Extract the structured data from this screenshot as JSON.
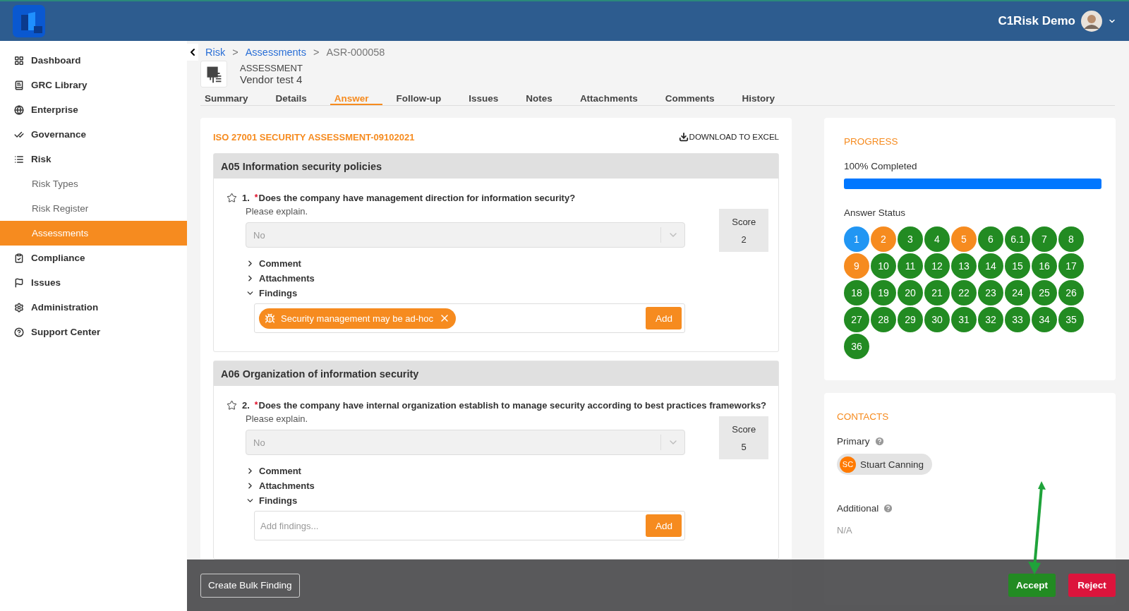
{
  "header": {
    "user_name": "C1Risk Demo"
  },
  "sidebar": {
    "items": [
      {
        "label": "Dashboard",
        "selected": false
      },
      {
        "label": "GRC Library",
        "selected": false
      },
      {
        "label": "Enterprise",
        "selected": false
      },
      {
        "label": "Governance",
        "selected": false
      },
      {
        "label": "Risk",
        "selected": false,
        "children": [
          {
            "label": "Risk Types",
            "selected": false
          },
          {
            "label": "Risk Register",
            "selected": false
          },
          {
            "label": "Assessments",
            "selected": true
          }
        ]
      },
      {
        "label": "Compliance",
        "selected": false
      },
      {
        "label": "Issues",
        "selected": false
      },
      {
        "label": "Administration",
        "selected": false
      },
      {
        "label": "Support Center",
        "selected": false
      }
    ]
  },
  "breadcrumb": [
    {
      "label": "Risk",
      "link": true
    },
    {
      "label": ">",
      "link": false
    },
    {
      "label": "Assessments",
      "link": true
    },
    {
      "label": ">",
      "link": false
    },
    {
      "label": "ASR-000058",
      "link": false
    }
  ],
  "record": {
    "type_label": "ASSESSMENT",
    "name": "Vendor test 4"
  },
  "tabs": [
    {
      "label": "Summary",
      "selected": false
    },
    {
      "label": "Details",
      "selected": false
    },
    {
      "label": "Answer",
      "selected": true
    },
    {
      "label": "Follow-up",
      "selected": false
    },
    {
      "label": "Issues",
      "selected": false
    },
    {
      "label": "Notes",
      "selected": false
    },
    {
      "label": "Attachments",
      "selected": false
    },
    {
      "label": "Comments",
      "selected": false
    },
    {
      "label": "History",
      "selected": false
    }
  ],
  "questionnaire": {
    "title": "ISO 27001 SECURITY ASSESSMENT-09102021",
    "download_label": "DOWNLOAD TO EXCEL",
    "sections": [
      {
        "title": "A05 Information security policies",
        "questions": [
          {
            "number": "1.",
            "required_mark": "*",
            "text": "Does the company have management direction for information security?",
            "hint": "Please explain.",
            "answer": "No",
            "score_label": "Score",
            "score": "2",
            "toggles": [
              {
                "label": "Comment",
                "expanded": false
              },
              {
                "label": "Attachments",
                "expanded": false
              },
              {
                "label": "Findings",
                "expanded": true
              }
            ],
            "findings": [
              {
                "label": "Security management may be ad-hoc"
              }
            ],
            "add_label": "Add"
          }
        ]
      },
      {
        "title": "A06 Organization of information security",
        "questions": [
          {
            "number": "2.",
            "required_mark": "*",
            "text": "Does the company have internal organization establish to manage security according to best practices frameworks?",
            "hint": "Please explain.",
            "answer": "No",
            "score_label": "Score",
            "score": "5",
            "toggles": [
              {
                "label": "Comment",
                "expanded": false
              },
              {
                "label": "Attachments",
                "expanded": false
              },
              {
                "label": "Findings",
                "expanded": true
              }
            ],
            "findings_placeholder": "Add findings...",
            "add_label": "Add"
          }
        ]
      }
    ]
  },
  "progress": {
    "title": "PROGRESS",
    "label": "100% Completed",
    "level": 1,
    "status_title": "Answer Status",
    "answers": [
      {
        "label": "1",
        "color": "#2196f3"
      },
      {
        "label": "2",
        "color": "#f68b1f"
      },
      {
        "label": "3",
        "color": "#228b22"
      },
      {
        "label": "4",
        "color": "#228b22"
      },
      {
        "label": "5",
        "color": "#f68b1f"
      },
      {
        "label": "6",
        "color": "#228b22"
      },
      {
        "label": "6.1",
        "color": "#228b22"
      },
      {
        "label": "7",
        "color": "#228b22"
      },
      {
        "label": "8",
        "color": "#228b22"
      },
      {
        "label": "9",
        "color": "#f68b1f"
      },
      {
        "label": "10",
        "color": "#228b22"
      },
      {
        "label": "11",
        "color": "#228b22"
      },
      {
        "label": "12",
        "color": "#228b22"
      },
      {
        "label": "13",
        "color": "#228b22"
      },
      {
        "label": "14",
        "color": "#228b22"
      },
      {
        "label": "15",
        "color": "#228b22"
      },
      {
        "label": "16",
        "color": "#228b22"
      },
      {
        "label": "17",
        "color": "#228b22"
      },
      {
        "label": "18",
        "color": "#228b22"
      },
      {
        "label": "19",
        "color": "#228b22"
      },
      {
        "label": "20",
        "color": "#228b22"
      },
      {
        "label": "21",
        "color": "#228b22"
      },
      {
        "label": "22",
        "color": "#228b22"
      },
      {
        "label": "23",
        "color": "#228b22"
      },
      {
        "label": "24",
        "color": "#228b22"
      },
      {
        "label": "25",
        "color": "#228b22"
      },
      {
        "label": "26",
        "color": "#228b22"
      },
      {
        "label": "27",
        "color": "#228b22"
      },
      {
        "label": "28",
        "color": "#228b22"
      },
      {
        "label": "29",
        "color": "#228b22"
      },
      {
        "label": "30",
        "color": "#228b22"
      },
      {
        "label": "31",
        "color": "#228b22"
      },
      {
        "label": "32",
        "color": "#228b22"
      },
      {
        "label": "33",
        "color": "#228b22"
      },
      {
        "label": "34",
        "color": "#228b22"
      },
      {
        "label": "35",
        "color": "#228b22"
      },
      {
        "label": "36",
        "color": "#228b22"
      }
    ]
  },
  "contacts": {
    "title": "CONTACTS",
    "primary_label": "Primary",
    "primary": {
      "initials": "SC",
      "name": "Stuart Canning"
    },
    "additional_label": "Additional",
    "additional": "N/A"
  },
  "footer": {
    "bulk_button": "Create Bulk Finding",
    "accept": "Accept",
    "reject": "Reject"
  }
}
